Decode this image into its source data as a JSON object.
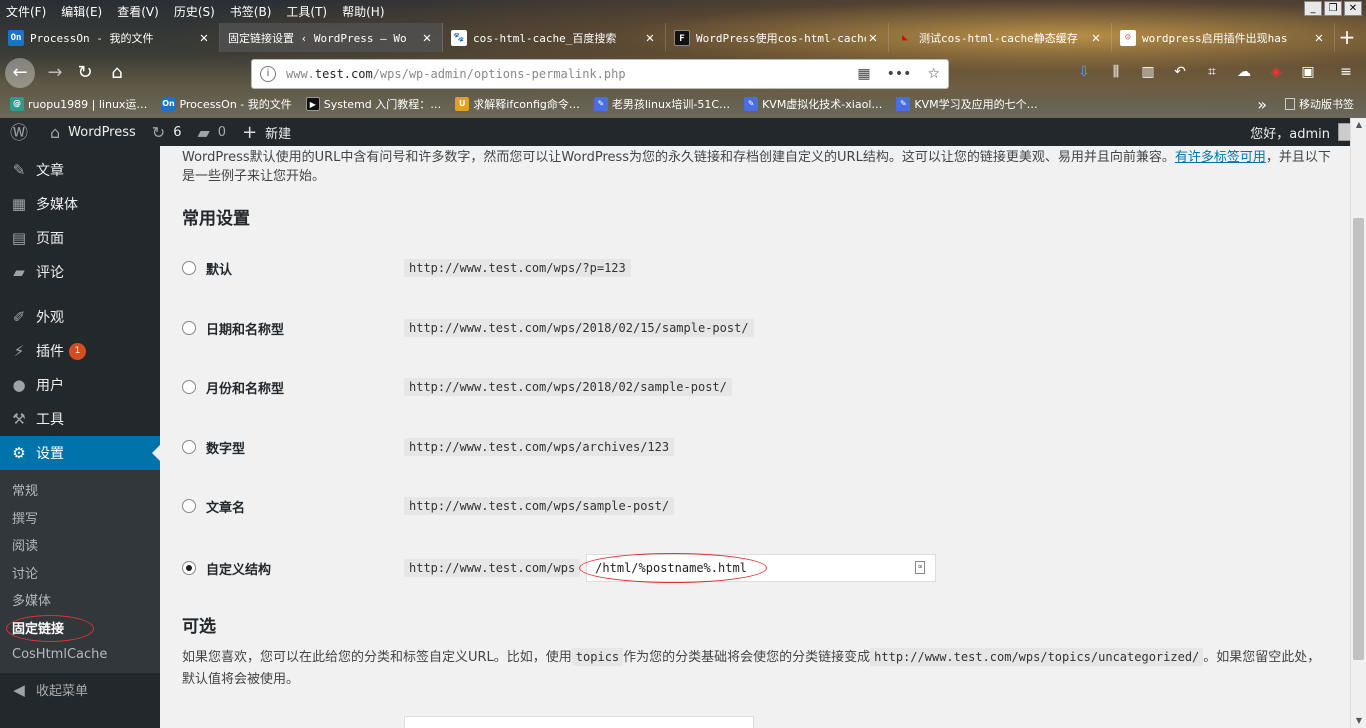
{
  "browser": {
    "menus": [
      "文件(F)",
      "编辑(E)",
      "查看(V)",
      "历史(S)",
      "书签(B)",
      "工具(T)",
      "帮助(H)"
    ],
    "window_controls": [
      "_",
      "❐",
      "✕"
    ],
    "tabs": [
      {
        "title": "ProcessOn - 我的文件",
        "icon": "On",
        "icon_color": "#1a73c9"
      },
      {
        "title": "固定链接设置 ‹ WordPress — Wo",
        "icon": "",
        "icon_color": ""
      },
      {
        "title": "cos-html-cache_百度搜索",
        "icon": "🐾",
        "icon_color": "#2932e1"
      },
      {
        "title": "WordPress使用cos-html-cache",
        "icon": "F",
        "icon_color": "#111"
      },
      {
        "title": "测试cos-html-cache静态缓存",
        "icon": "◣",
        "icon_color": "#d00"
      },
      {
        "title": "wordpress启用插件出现has",
        "icon": "☺",
        "icon_color": "#eee"
      }
    ],
    "new_tab": "+",
    "url_prefix": "www.",
    "url_domain": "test.com",
    "url_path": "/wps/wp-admin/options-permalink.php",
    "bookmarks": [
      {
        "label": "ruopu1989 | linux运…",
        "icon": "@",
        "color": "#2a9d8f"
      },
      {
        "label": "ProcessOn - 我的文件",
        "icon": "On",
        "color": "#1a73c9"
      },
      {
        "label": "Systemd 入门教程：…",
        "icon": "▶",
        "color": "#111"
      },
      {
        "label": "求解释ifconfig命令…",
        "icon": "U",
        "color": "#e0a020"
      },
      {
        "label": "老男孩linux培训-51C…",
        "icon": "✎",
        "color": "#4a6ee0"
      },
      {
        "label": "KVM虚拟化技术-xiaol…",
        "icon": "✎",
        "color": "#4a6ee0"
      },
      {
        "label": "KVM学习及应用的七个…",
        "icon": "✎",
        "color": "#4a6ee0"
      }
    ],
    "bookmarks_more": "»",
    "mobile_bookmarks": "移动版书签"
  },
  "adminbar": {
    "site_name": "WordPress",
    "updates_count": "6",
    "comments_count": "0",
    "new_label": "新建",
    "greeting": "您好，admin"
  },
  "sidebar": {
    "items": [
      {
        "label": "文章",
        "icon": "📌"
      },
      {
        "label": "多媒体",
        "icon": "🎞"
      },
      {
        "label": "页面",
        "icon": "▤"
      },
      {
        "label": "评论",
        "icon": "💬"
      },
      {
        "label": "外观",
        "icon": "🖌"
      },
      {
        "label": "插件",
        "icon": "🔌",
        "badge": "1"
      },
      {
        "label": "用户",
        "icon": "👤"
      },
      {
        "label": "工具",
        "icon": "🔧"
      },
      {
        "label": "设置",
        "icon": "⚙"
      }
    ],
    "submenu": [
      "常规",
      "撰写",
      "阅读",
      "讨论",
      "多媒体",
      "固定链接",
      "CosHtmlCache"
    ],
    "collapse_label": "收起菜单"
  },
  "main": {
    "intro_text": "WordPress默认使用的URL中含有问号和许多数字，然而您可以让WordPress为您的永久链接和存档创建自定义的URL结构。这可以让您的链接更美观、易用并且向前兼容。",
    "intro_link": "有许多标签可用",
    "intro_tail": "，并且以下是一些例子来让您开始。",
    "common_heading": "常用设置",
    "options": [
      {
        "label": "默认",
        "example": "http://www.test.com/wps/?p=123",
        "checked": false
      },
      {
        "label": "日期和名称型",
        "example": "http://www.test.com/wps/2018/02/15/sample-post/",
        "checked": false
      },
      {
        "label": "月份和名称型",
        "example": "http://www.test.com/wps/2018/02/sample-post/",
        "checked": false
      },
      {
        "label": "数字型",
        "example": "http://www.test.com/wps/archives/123",
        "checked": false
      },
      {
        "label": "文章名",
        "example": "http://www.test.com/wps/sample-post/",
        "checked": false
      },
      {
        "label": "自定义结构",
        "example": "http://www.test.com/wps",
        "checked": true
      }
    ],
    "custom_value": "/html/%postname%.html",
    "optional_heading": "可选",
    "optional_text_1": "如果您喜欢，您可以在此给您的分类和标签自定义URL。比如，使用",
    "optional_code_1": "topics",
    "optional_text_2": "作为您的分类基础将会使您的分类链接变成",
    "optional_code_2": "http://www.test.com/wps/topics/uncategorized/",
    "optional_text_3": "。如果您留空此处，默认值将会被使用。"
  }
}
